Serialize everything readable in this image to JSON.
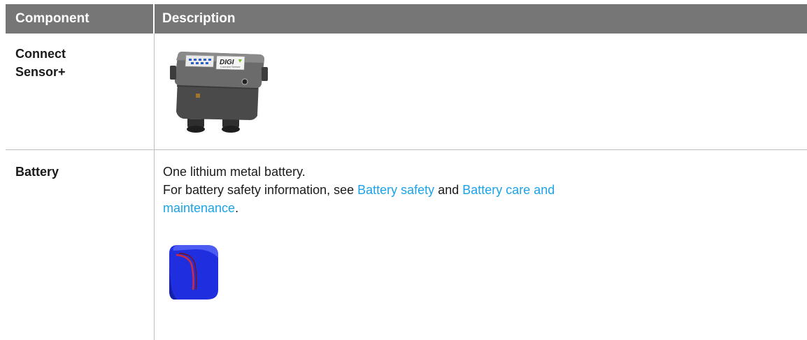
{
  "table": {
    "headers": [
      "Component",
      "Description"
    ],
    "rows": [
      {
        "component": "Connect Sensor+",
        "component_lines": [
          "Connect",
          "Sensor+"
        ],
        "device_brand": "DIGI",
        "device_model_text": "Connect Sensor"
      },
      {
        "component": "Battery",
        "description_line1": "One lithium metal battery.",
        "description_line2_prefix": "For battery safety information, see ",
        "link1": "Battery safety",
        "connector": " and ",
        "link2_part1": "Battery care and",
        "link2_part2": "maintenance",
        "trailing": "."
      }
    ]
  },
  "colors": {
    "header_bg": "#767676",
    "header_text": "#ffffff",
    "link": "#1aa3e8",
    "battery_blue": "#1f2fe0"
  }
}
